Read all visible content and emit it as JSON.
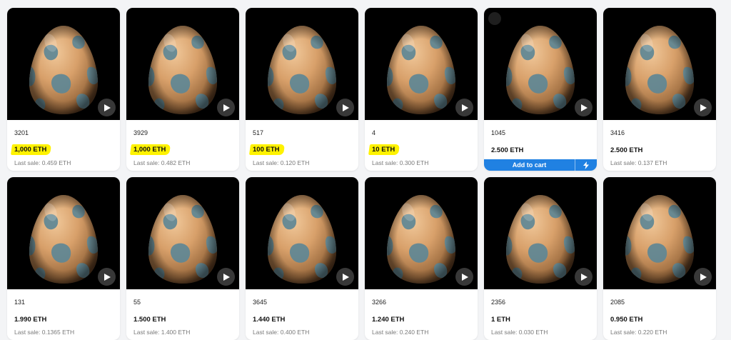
{
  "currency": "ETH",
  "colors": {
    "highlight": "#fff200",
    "cart_button": "#2081e2",
    "media_bg": "#000000"
  },
  "listings": [
    {
      "id": "3201",
      "price": "1,000 ETH",
      "last_sale": "Last sale: 0.459 ETH",
      "highlighted": true
    },
    {
      "id": "3929",
      "price": "1,000 ETH",
      "last_sale": "Last sale: 0.482 ETH",
      "highlighted": true
    },
    {
      "id": "517",
      "price": "100 ETH",
      "last_sale": "Last sale: 0.120 ETH",
      "highlighted": true
    },
    {
      "id": "4",
      "price": "10 ETH",
      "last_sale": "Last sale: 0.300 ETH",
      "highlighted": true
    },
    {
      "id": "1045",
      "price": "2.500 ETH",
      "last_sale": "",
      "highlighted": false,
      "cart_label": "Add to cart"
    },
    {
      "id": "3416",
      "price": "2.500 ETH",
      "last_sale": "Last sale: 0.137 ETH",
      "highlighted": false
    },
    {
      "id": "131",
      "price": "1.990 ETH",
      "last_sale": "Last sale: 0.1365 ETH",
      "highlighted": false
    },
    {
      "id": "55",
      "price": "1.500 ETH",
      "last_sale": "Last sale: 1.400 ETH",
      "highlighted": false
    },
    {
      "id": "3645",
      "price": "1.440 ETH",
      "last_sale": "Last sale: 0.400 ETH",
      "highlighted": false
    },
    {
      "id": "3266",
      "price": "1.240 ETH",
      "last_sale": "Last sale: 0.240 ETH",
      "highlighted": false
    },
    {
      "id": "2356",
      "price": "1 ETH",
      "last_sale": "Last sale: 0.030 ETH",
      "highlighted": false
    },
    {
      "id": "2085",
      "price": "0.950 ETH",
      "last_sale": "Last sale: 0.220 ETH",
      "highlighted": false
    }
  ],
  "icons": {
    "play": "play-icon",
    "bolt": "lightning-icon",
    "image": "egg-image"
  }
}
